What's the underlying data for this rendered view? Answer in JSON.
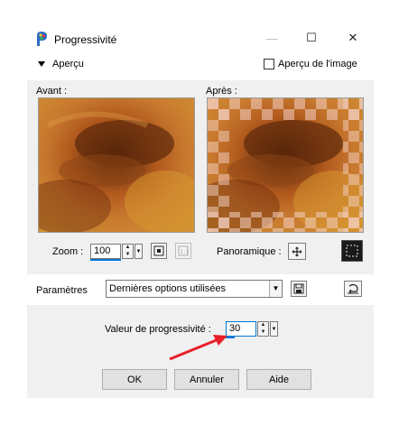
{
  "window": {
    "title": "Progressivité",
    "minimize_glyph": "—",
    "maximize_glyph": "☐",
    "close_glyph": "✕"
  },
  "aperçu": {
    "label": "Aperçu",
    "image_preview_label": "Aperçu de l'image"
  },
  "preview": {
    "before_label": "Avant :",
    "after_label": "Après :",
    "zoom_label": "Zoom :",
    "zoom_value": "100",
    "pan_label": "Panoramique :"
  },
  "params": {
    "label": "Paramètres",
    "preset_value": "Dernières options utilisées"
  },
  "settings": {
    "progressivity_label": "Valeur de progressivité :",
    "progressivity_value": "30"
  },
  "buttons": {
    "ok": "OK",
    "cancel": "Annuler",
    "help": "Aide"
  },
  "colors": {
    "arrow": "#e8202a",
    "panel_bg": "#f0f0f0",
    "focus_underline": "#0078d7"
  }
}
